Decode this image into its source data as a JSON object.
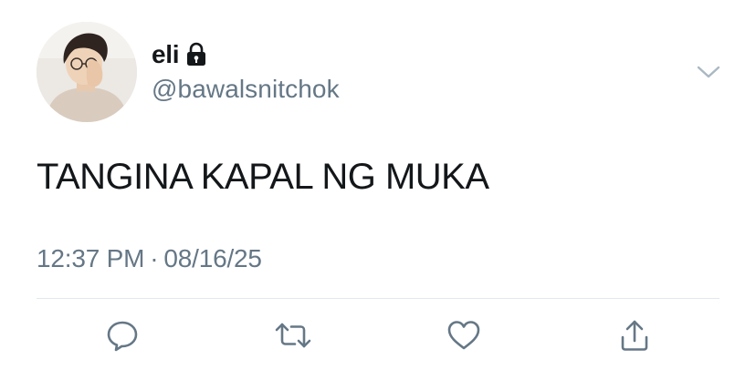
{
  "tweet": {
    "author": {
      "display_name": "eli",
      "handle": "@bawalsnitchok",
      "protected_icon": "lock-icon"
    },
    "text": "TANGINA KAPAL NG MUKA",
    "time": "12:37 PM",
    "separator": "·",
    "date": "08/16/25"
  },
  "actions": {
    "reply_icon": "reply-icon",
    "retweet_icon": "retweet-icon",
    "like_icon": "heart-icon",
    "share_icon": "share-icon"
  },
  "colors": {
    "text_primary": "#14171a",
    "text_secondary": "#657786",
    "divider": "#e1e8ed",
    "icon": "#657786"
  }
}
